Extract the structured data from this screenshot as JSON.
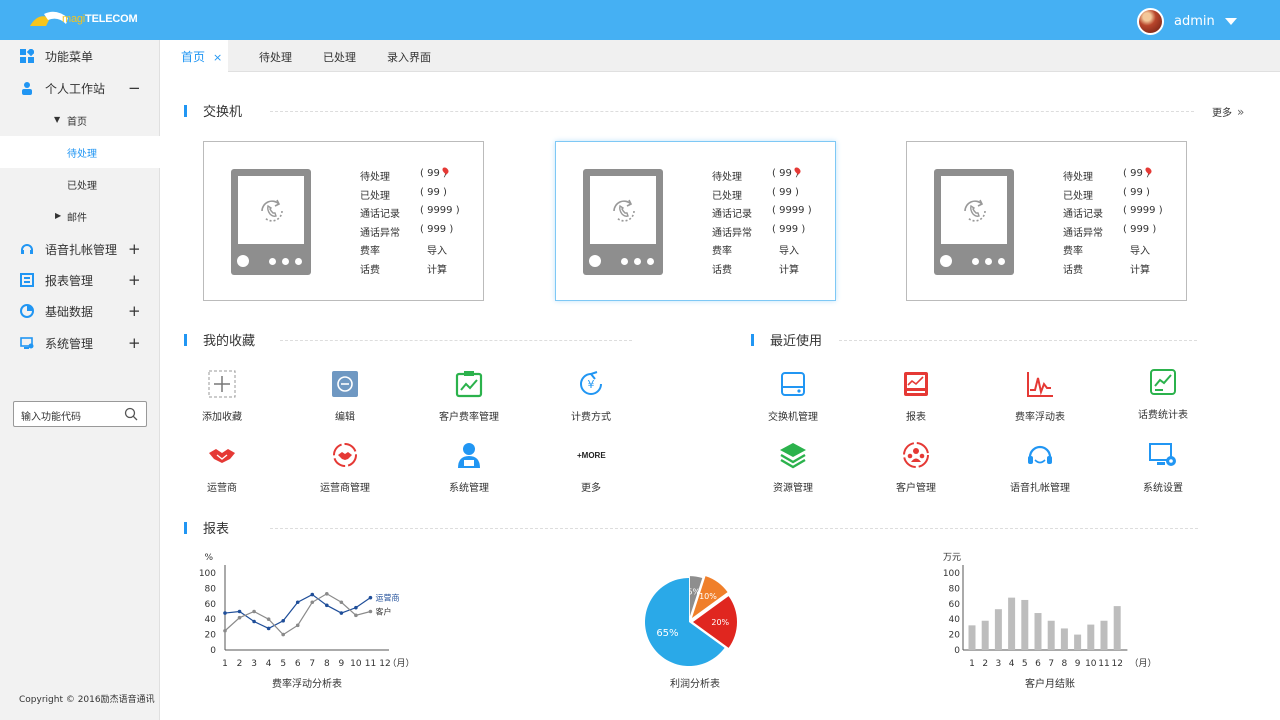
{
  "header": {
    "brand_prefix": "magi",
    "brand": "TELECOM",
    "user": "admin"
  },
  "sidebar": {
    "menu": "功能菜单",
    "workstation": "个人工作站",
    "home": "首页",
    "pending": "待处理",
    "processed": "已处理",
    "mail": "邮件",
    "voice": "语音扎帐管理",
    "report": "报表管理",
    "basic": "基础数据",
    "system": "系统管理",
    "search_placeholder": "输入功能代码",
    "copyright": "Copyright © 2016励杰语音通讯"
  },
  "tabs": {
    "home": "首页",
    "close": "×",
    "pending": "待处理",
    "processed": "已处理",
    "entry": "录入界面"
  },
  "switch": {
    "title": "交换机",
    "more": "更多",
    "labels": {
      "pending": "待处理",
      "processed": "已处理",
      "records": "通话记录",
      "abnormal": "通话异常",
      "rate": "费率",
      "fee": "话费"
    },
    "values": {
      "pending": "( 99 )",
      "processed": "( 99 )",
      "records": "( 9999 )",
      "abnormal": "( 999 )",
      "rate": "导入",
      "fee": "计算"
    }
  },
  "favorites": {
    "title": "我的收藏",
    "items": [
      "添加收藏",
      "编辑",
      "客户费率管理",
      "计费方式",
      "运营商",
      "运营商管理",
      "系统管理",
      "更多"
    ],
    "more_icon": "+MORE"
  },
  "recent": {
    "title": "最近使用",
    "items": [
      "交换机管理",
      "报表",
      "费率浮动表",
      "话费统计表",
      "资源管理",
      "客户管理",
      "语音扎帐管理",
      "系统设置"
    ]
  },
  "reports": {
    "title": "报表"
  },
  "colors": {
    "accent": "#2196f3",
    "topbar": "#45b0f3",
    "icon_red": "#e53935",
    "icon_green": "#2bb24c",
    "icon_blue": "#2196f3"
  },
  "chart_data": [
    {
      "type": "line",
      "title": "费率浮动分析表",
      "ylabel": "%",
      "xlabel": "（月）",
      "x": [
        1,
        2,
        3,
        4,
        5,
        6,
        7,
        8,
        9,
        10,
        11,
        12
      ],
      "ylim": [
        0,
        100
      ],
      "yticks": [
        0,
        20,
        40,
        60,
        80,
        100
      ],
      "series": [
        {
          "name": "运营商",
          "color": "#1f4e99",
          "values": [
            48,
            50,
            37,
            28,
            38,
            62,
            72,
            58,
            48,
            55,
            68
          ]
        },
        {
          "name": "客户",
          "color": "#8a8a8a",
          "values": [
            25,
            42,
            50,
            40,
            20,
            32,
            62,
            73,
            62,
            45,
            50
          ]
        }
      ]
    },
    {
      "type": "pie",
      "title": "利润分析表",
      "slices": [
        {
          "label": "65%",
          "value": 65,
          "color": "#2aa9e8"
        },
        {
          "label": "20%",
          "value": 20,
          "color": "#e0261f"
        },
        {
          "label": "10%",
          "value": 10,
          "color": "#f07f2a"
        },
        {
          "label": "5%",
          "value": 5,
          "color": "#8e8e8e"
        }
      ]
    },
    {
      "type": "bar",
      "title": "客户月结账",
      "ylabel": "万元",
      "xlabel": "（月）",
      "categories": [
        "1",
        "2",
        "3",
        "4",
        "5",
        "6",
        "7",
        "8",
        "9",
        "10",
        "11",
        "12"
      ],
      "ylim": [
        0,
        100
      ],
      "yticks": [
        0,
        20,
        40,
        60,
        80,
        100
      ],
      "values": [
        32,
        38,
        53,
        68,
        65,
        48,
        38,
        28,
        20,
        33,
        38,
        57
      ]
    }
  ]
}
